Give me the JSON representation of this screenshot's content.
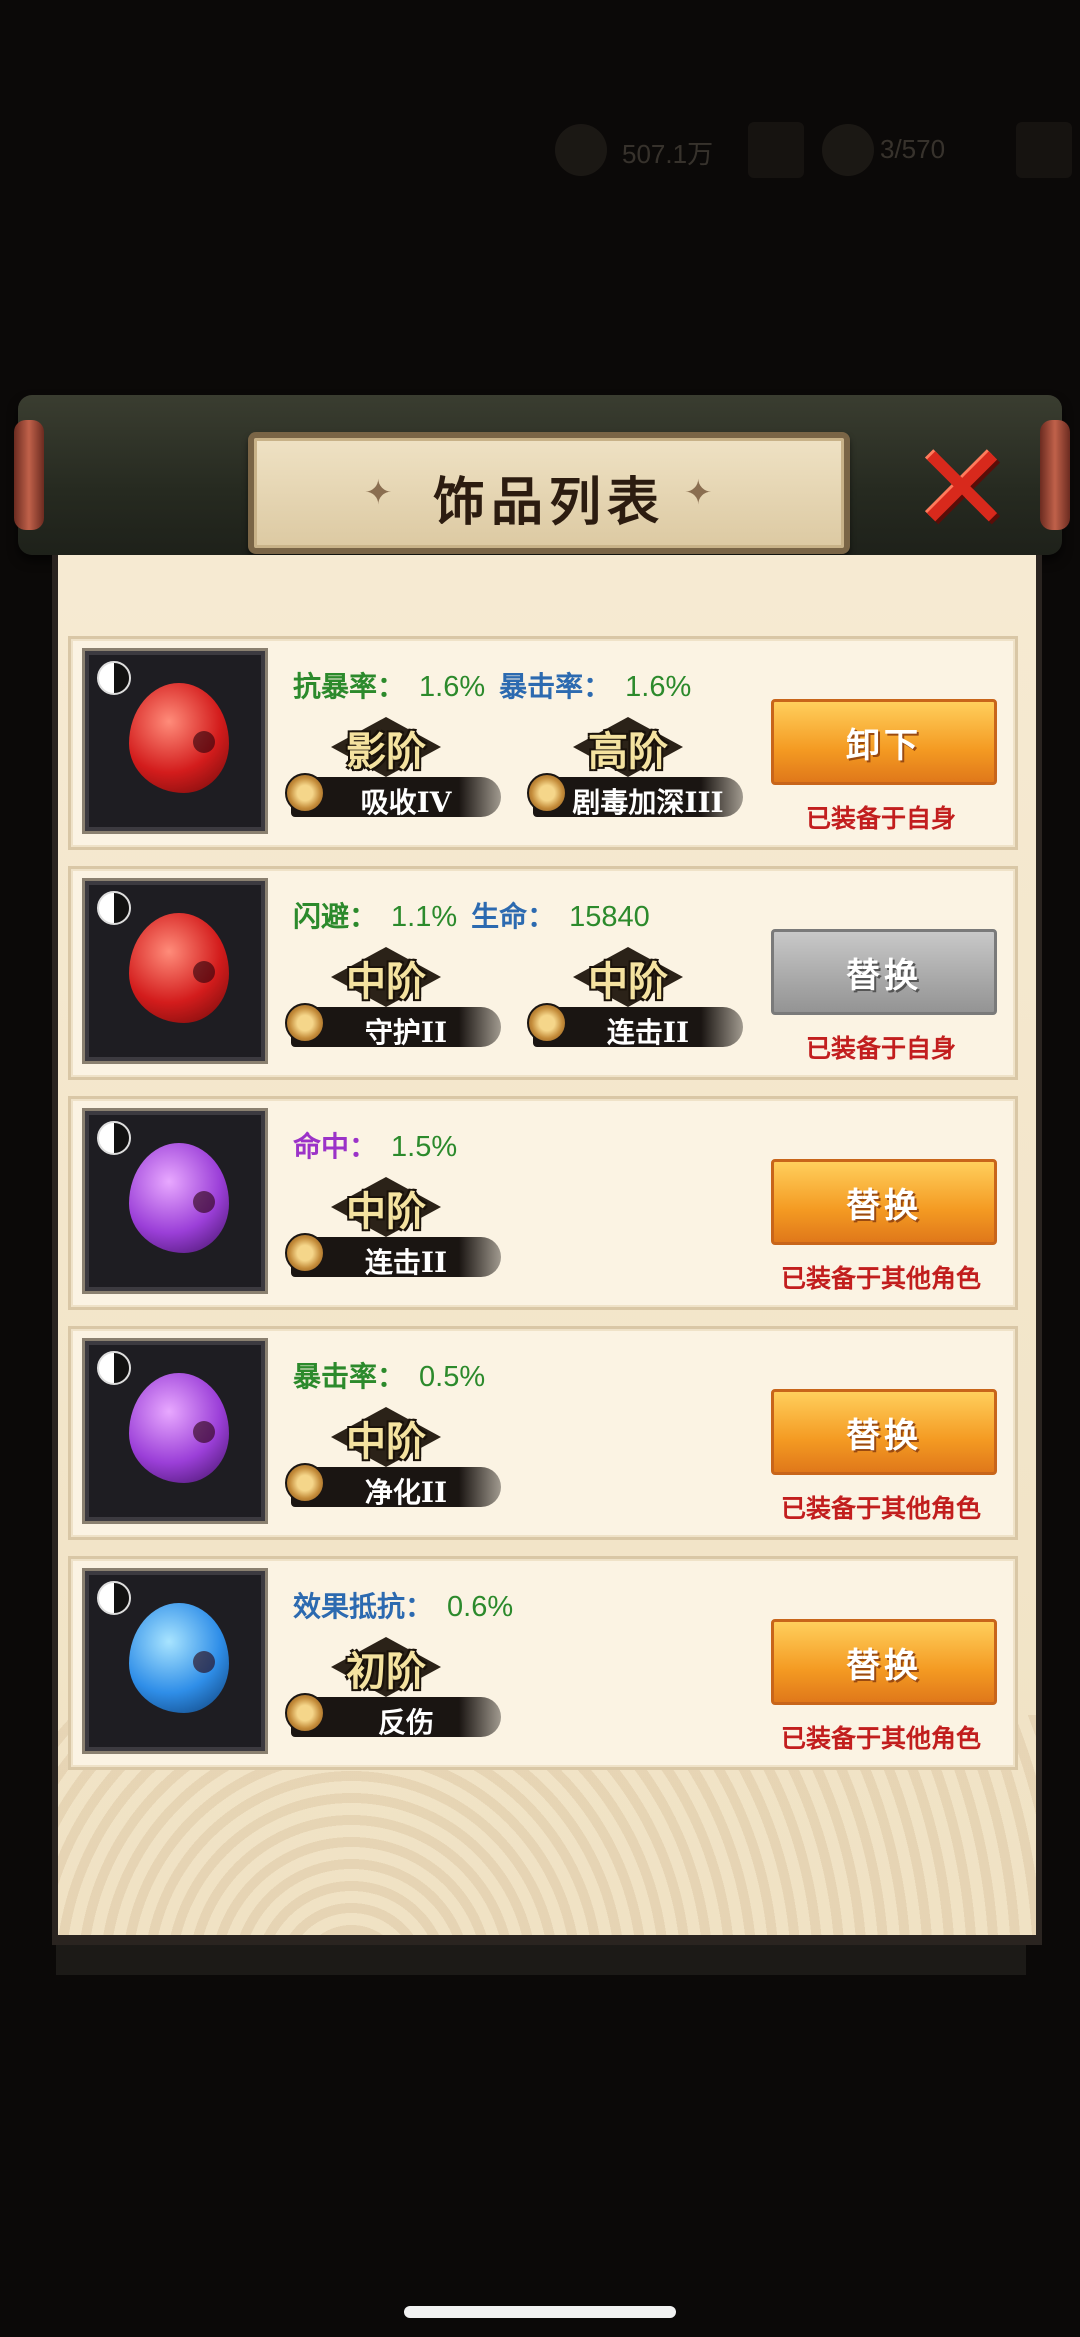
{
  "header": {
    "title": "饰品列表",
    "coins": "507.1万",
    "capacity": "3/570"
  },
  "cards": [
    {
      "stats": [
        {
          "label": "抗暴率：",
          "value": "1.6%",
          "color": "#2c8a2c"
        },
        {
          "label": "暴击率：",
          "value": "1.6%",
          "color": "#2c6ab0"
        }
      ],
      "skills": [
        {
          "tier": "影阶",
          "name": "吸收IV"
        },
        {
          "tier": "高阶",
          "name": "剧毒加深III"
        }
      ],
      "button": "卸下",
      "button_style": "orange",
      "equip_note": "已装备于自身",
      "orb_color": "red"
    },
    {
      "stats": [
        {
          "label": "闪避：",
          "value": "1.1%",
          "color": "#2c8a2c"
        },
        {
          "label": "生命：",
          "value": "15840",
          "color": "#2c6ab0"
        }
      ],
      "skills": [
        {
          "tier": "中阶",
          "name": "守护II"
        },
        {
          "tier": "中阶",
          "name": "连击II"
        }
      ],
      "button": "替换",
      "button_style": "gray",
      "equip_note": "已装备于自身",
      "orb_color": "red"
    },
    {
      "stats": [
        {
          "label": "命中：",
          "value": "1.5%",
          "color": "#9b32c8"
        }
      ],
      "skills": [
        {
          "tier": "中阶",
          "name": "连击II"
        }
      ],
      "button": "替换",
      "button_style": "orange",
      "equip_note": "已装备于其他角色",
      "orb_color": "purple"
    },
    {
      "stats": [
        {
          "label": "暴击率：",
          "value": "0.5%",
          "color": "#2c8a2c"
        }
      ],
      "skills": [
        {
          "tier": "中阶",
          "name": "净化II"
        }
      ],
      "button": "替换",
      "button_style": "orange",
      "equip_note": "已装备于其他角色",
      "orb_color": "purple"
    },
    {
      "stats": [
        {
          "label": "效果抵抗：",
          "value": "0.6%",
          "color": "#2c6ab0"
        }
      ],
      "skills": [
        {
          "tier": "初阶",
          "name": "反伤"
        }
      ],
      "button": "替换",
      "button_style": "orange",
      "equip_note": "已装备于其他角色",
      "orb_color": "blue"
    }
  ]
}
